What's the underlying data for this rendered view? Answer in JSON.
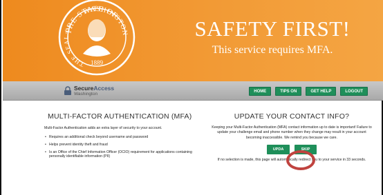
{
  "header": {
    "title": "SAFETY FIRST!",
    "subtitle": "This service requires MFA.",
    "seal": {
      "top_text": "THE STATE OF",
      "right_text": "WASHINGTON",
      "left_text": "THE SEAL OF",
      "year": "1889"
    }
  },
  "logo": {
    "main_secure": "Secure",
    "main_access": "Access",
    "sub": "Washington"
  },
  "nav": {
    "home": "HOME",
    "tips_on": "TIPS ON",
    "get_help": "GET HELP",
    "logout": "LOGOUT"
  },
  "mfa": {
    "heading": "MULTI-FACTOR AUTHENTICATION (MFA)",
    "intro": "Multi-Factor Authentication adds an extra layer of security to your account.",
    "bullets": [
      "Requires an additional check beyond username and password",
      "Helps prevent identity theft and fraud",
      "Is an Office of the Chief Information Officer (OCIO) requirement for applications containing personally identifiable information (PII)"
    ]
  },
  "contact": {
    "heading": "UPDATE YOUR CONTACT INFO?",
    "body": "Keeping your Multi-Factor Authentication (MFA) contact information up to date is important! Failure to update your challenge email and phone number when they change may result in your account becoming inaccessible. We remind you because we care.",
    "update_label": "UPDA",
    "skip_label": "SKIP",
    "note": "If no selection is made, this page will automatically redirect you to your service in 33 seconds."
  },
  "colors": {
    "header_orange": "#f29a35",
    "button_green": "#1f8f5a",
    "annotation_red": "#c0433f"
  },
  "icons": [
    "washington-state-seal",
    "lock-icon"
  ]
}
